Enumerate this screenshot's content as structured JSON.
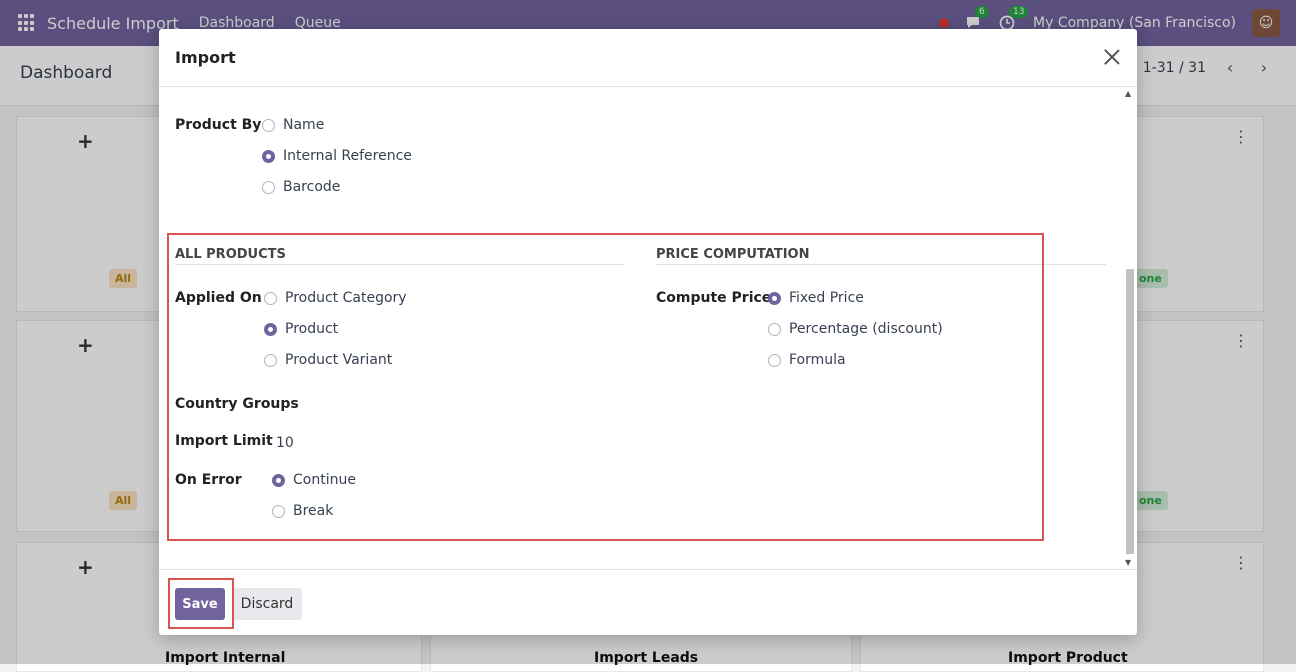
{
  "navbar": {
    "app_title": "Schedule Import",
    "menu": [
      "Dashboard",
      "Queue"
    ],
    "messages_count": "6",
    "activities_count": "13",
    "company": "My Company (San Francisco)"
  },
  "control": {
    "breadcrumb": "Dashboard",
    "pager": "1-31 / 31"
  },
  "background_cards": {
    "tag_all": "All",
    "tag_done": "one",
    "titles": [
      "Import Internal",
      "Import Leads",
      "Import Product"
    ]
  },
  "modal": {
    "title": "Import",
    "product_by": {
      "label": "Product By",
      "options": [
        "Name",
        "Internal Reference",
        "Barcode"
      ],
      "selected": "Internal Reference"
    },
    "all_products": {
      "section_title": "ALL PRODUCTS",
      "applied_on": {
        "label": "Applied On",
        "options": [
          "Product Category",
          "Product",
          "Product Variant"
        ],
        "selected": "Product"
      },
      "country_groups_label": "Country Groups",
      "import_limit": {
        "label": "Import Limit",
        "value": "10"
      },
      "on_error": {
        "label": "On Error",
        "options": [
          "Continue",
          "Break"
        ],
        "selected": "Continue"
      }
    },
    "price_computation": {
      "section_title": "PRICE COMPUTATION",
      "compute_price": {
        "label": "Compute Price",
        "options": [
          "Fixed Price",
          "Percentage (discount)",
          "Formula"
        ],
        "selected": "Fixed Price"
      }
    },
    "footer": {
      "save_label": "Save",
      "discard_label": "Discard"
    }
  },
  "colors": {
    "brand": "#71639e",
    "highlight": "#d9534f"
  }
}
